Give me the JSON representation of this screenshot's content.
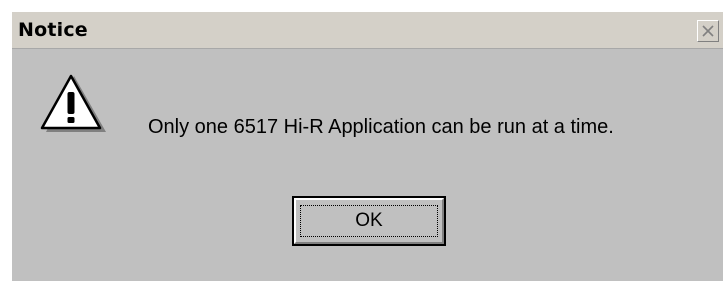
{
  "window": {
    "title": "Notice"
  },
  "icons": {
    "close": "close-icon",
    "warning": "warning-icon"
  },
  "message": {
    "text": "Only one 6517 Hi-R Application can be run at a time."
  },
  "buttons": {
    "ok_label": "OK"
  },
  "colors": {
    "dialog_background": "#c0c0c0",
    "titlebar_background": "#d4d0c8",
    "text": "#000000"
  }
}
